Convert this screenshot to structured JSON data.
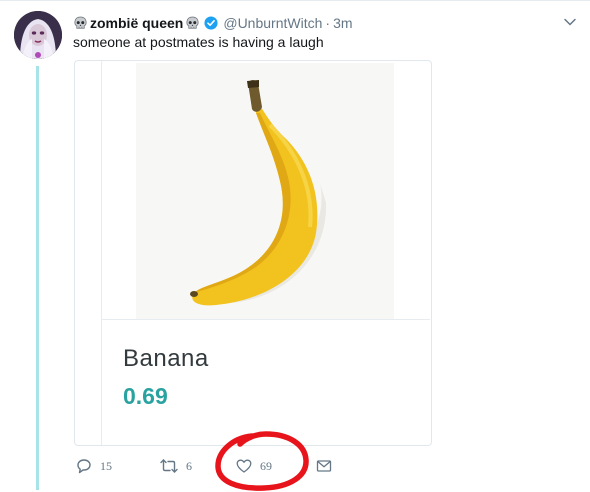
{
  "tweet": {
    "display_name": "zombië queen",
    "handle": "@UnburntWitch",
    "separator": "·",
    "time": "3m",
    "text": "someone at postmates is having a laugh",
    "verified_color": "#1da1f2"
  },
  "card": {
    "product_name": "Banana",
    "product_price": "0.69",
    "price_color": "#2aa3a0"
  },
  "actions": {
    "reply_count": "15",
    "retweet_count": "6",
    "like_count": "69"
  },
  "icons": [
    "skull-icon",
    "verified-badge-icon",
    "chevron-down-icon",
    "reply-icon",
    "retweet-icon",
    "heart-icon",
    "mail-icon"
  ],
  "colors": {
    "thread_line": "#a8e3e8",
    "annotation_circle": "#e8141b",
    "action_gray": "#657786"
  }
}
